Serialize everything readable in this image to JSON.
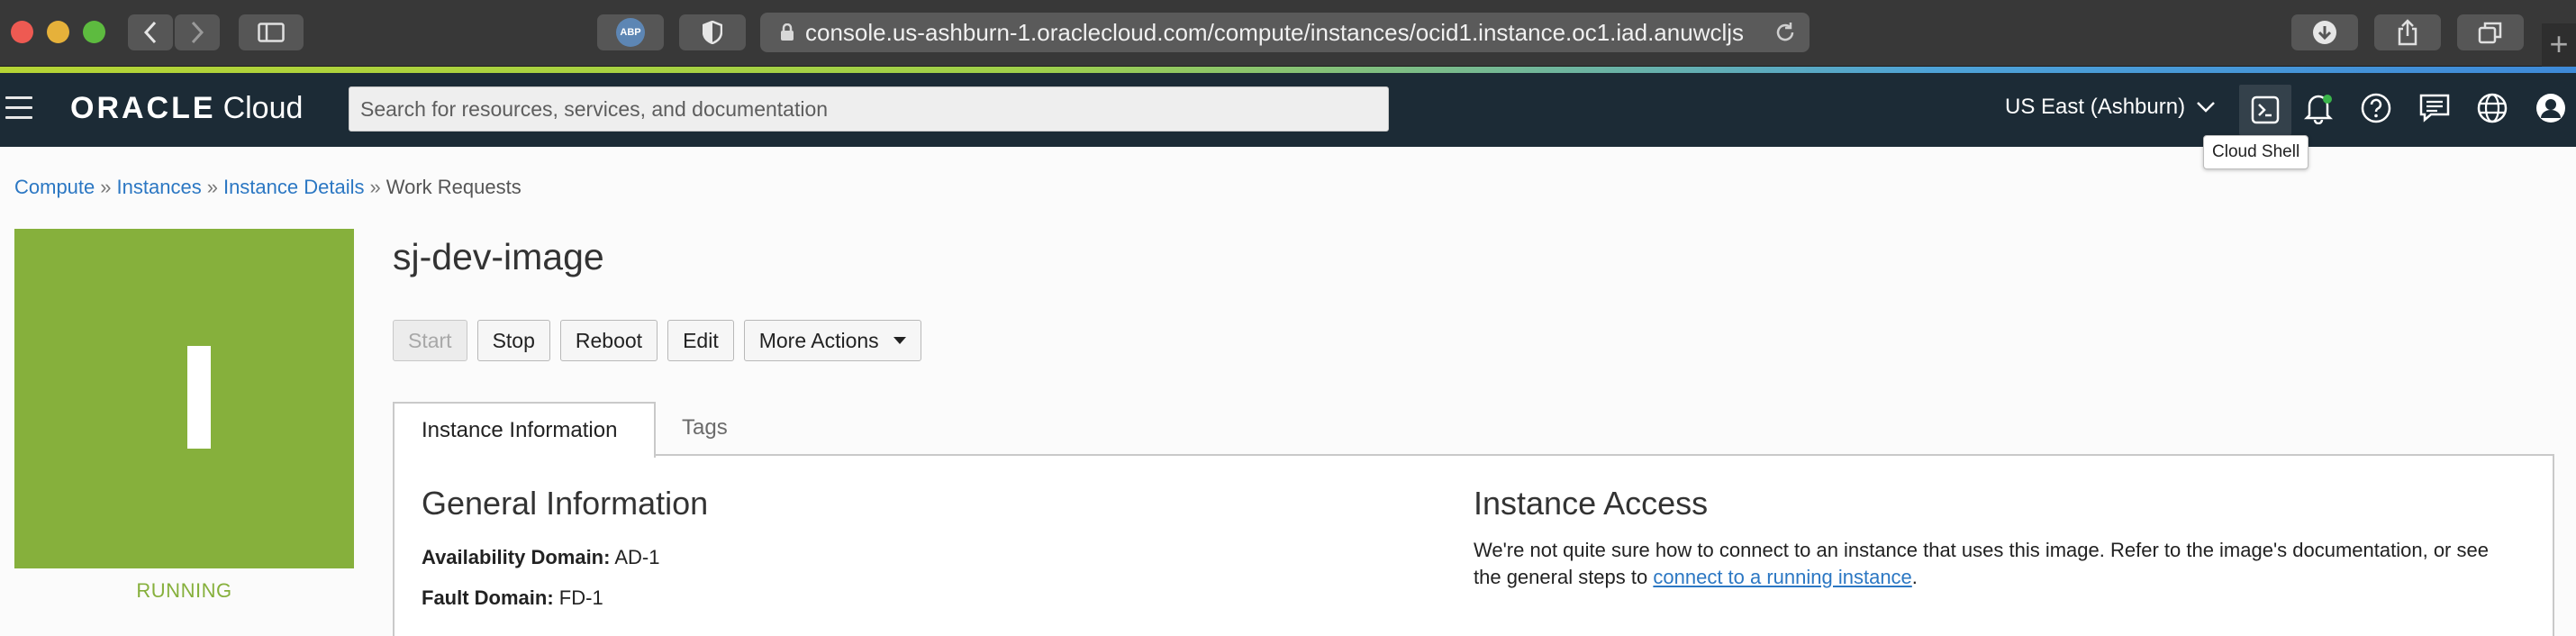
{
  "browser": {
    "url": "console.us-ashburn-1.oraclecloud.com/compute/instances/ocid1.instance.oc1.iad.anuwcljs",
    "extension_badge": "ABP"
  },
  "header": {
    "brand": "ORACLE",
    "product": "Cloud",
    "search_placeholder": "Search for resources, services, and documentation",
    "region": "US East (Ashburn)",
    "tooltip": "Cloud Shell"
  },
  "breadcrumb": {
    "items": [
      "Compute",
      "Instances",
      "Instance Details"
    ],
    "current": "Work Requests",
    "separator": "»"
  },
  "instance": {
    "name": "sj-dev-image",
    "status": "RUNNING",
    "status_color": "#86b03c"
  },
  "actions": {
    "start": "Start",
    "stop": "Stop",
    "reboot": "Reboot",
    "edit": "Edit",
    "more": "More Actions"
  },
  "tabs": {
    "info": "Instance Information",
    "tags": "Tags"
  },
  "general": {
    "title": "General Information",
    "ad_label": "Availability Domain:",
    "ad_value": "AD-1",
    "fd_label": "Fault Domain:",
    "fd_value": "FD-1"
  },
  "access": {
    "title": "Instance Access",
    "text": "We're not quite sure how to connect to an instance that uses this image. Refer to the image's documentation, or see the general steps to",
    "link": "connect to a running instance",
    "suffix": "."
  },
  "colors": {
    "header_bg": "#1c2b36",
    "link": "#2b77c3"
  }
}
